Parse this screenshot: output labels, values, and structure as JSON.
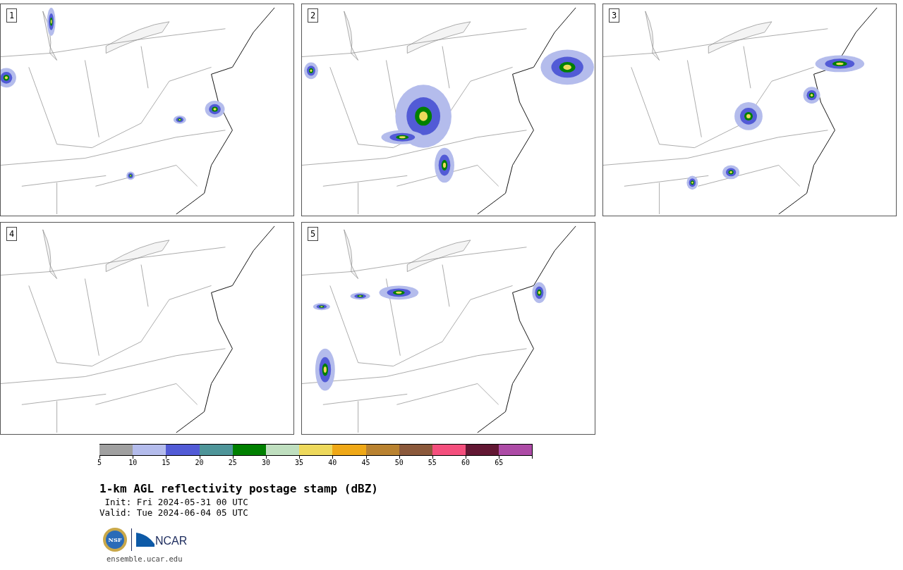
{
  "panels": [
    {
      "number": "1"
    },
    {
      "number": "2"
    },
    {
      "number": "3"
    },
    {
      "number": "4"
    },
    {
      "number": "5"
    }
  ],
  "colorbar": {
    "segments": [
      {
        "color": "#a0a0a0",
        "label": "5"
      },
      {
        "color": "#b4bcec",
        "label": "10"
      },
      {
        "color": "#525bd6",
        "label": "15"
      },
      {
        "color": "#4e9599",
        "label": "20"
      },
      {
        "color": "#008000",
        "label": "25"
      },
      {
        "color": "#bfdfbf",
        "label": "30"
      },
      {
        "color": "#eed95c",
        "label": "35"
      },
      {
        "color": "#efa817",
        "label": "40"
      },
      {
        "color": "#b98230",
        "label": "45"
      },
      {
        "color": "#8b593b",
        "label": "50"
      },
      {
        "color": "#f44f7d",
        "label": "55"
      },
      {
        "color": "#621733",
        "label": "60"
      },
      {
        "color": "#ad4ba6",
        "label": "65"
      }
    ]
  },
  "title": "1-km AGL reflectivity postage stamp (dBZ)",
  "init": " Init: Fri 2024-05-31 00 UTC",
  "valid": "Valid: Tue 2024-06-04 05 UTC",
  "logos": {
    "nsf": "NSF",
    "ncar": "NCAR"
  },
  "url": "ensemble.ucar.edu"
}
